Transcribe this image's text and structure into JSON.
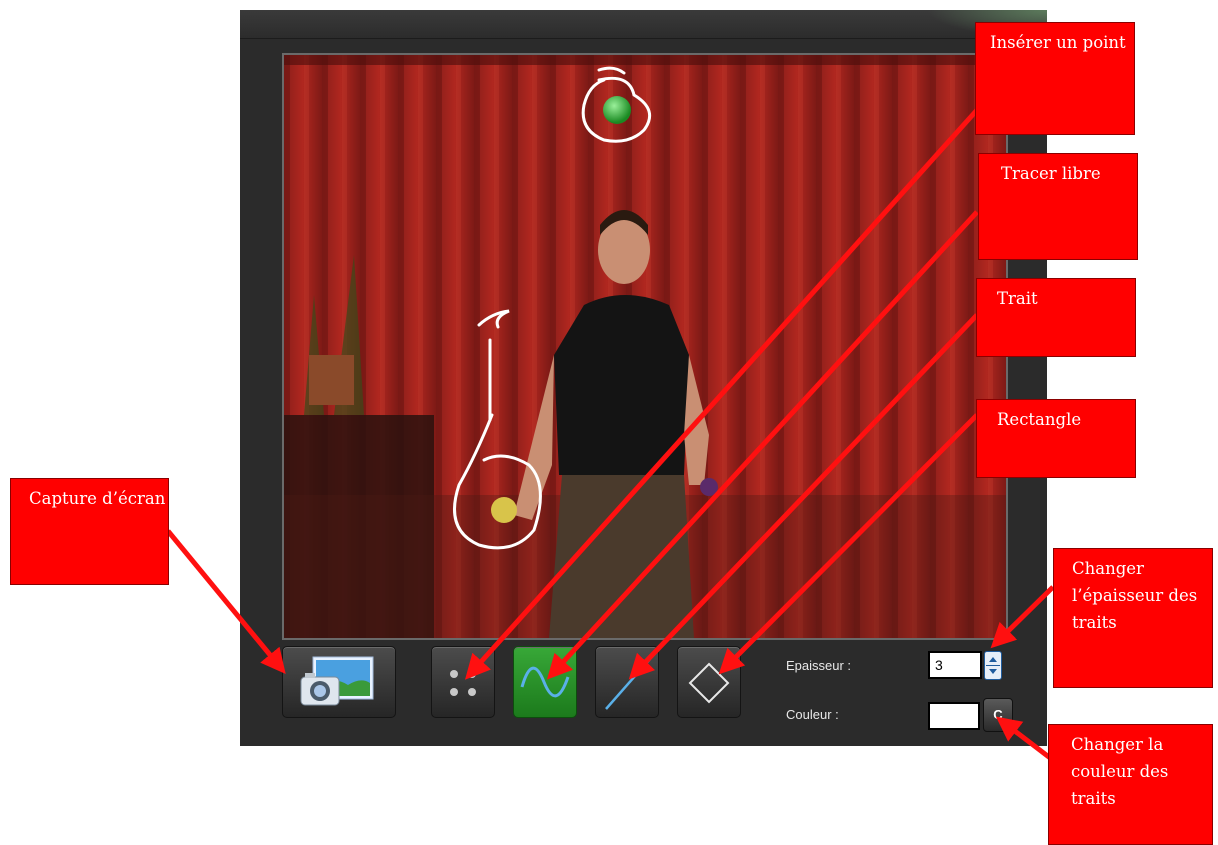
{
  "toolbar": {
    "capture_icon": "camera-photo-icon",
    "point_icon": "four-dots-icon",
    "freehand_icon": "sine-wave-icon",
    "line_icon": "diagonal-line-icon",
    "rectangle_icon": "diamond-icon",
    "thickness_label": "Epaisseur :",
    "thickness_value": "3",
    "color_label": "Couleur :",
    "color_button_label": "C",
    "active_tool": "freehand"
  },
  "annotations": {
    "point": "Insérer un point",
    "freehand": "Tracer libre",
    "line": "Trait",
    "rectangle": "Rectangle",
    "capture": "Capture d’écran",
    "thickness": "Changer l’épaisseur des traits",
    "color": "Changer la couleur des traits"
  },
  "colors": {
    "callout": "#ff0000",
    "panel": "#2b2b2b",
    "active_button": "#2a992a",
    "stroke_color": "#ffffff"
  }
}
